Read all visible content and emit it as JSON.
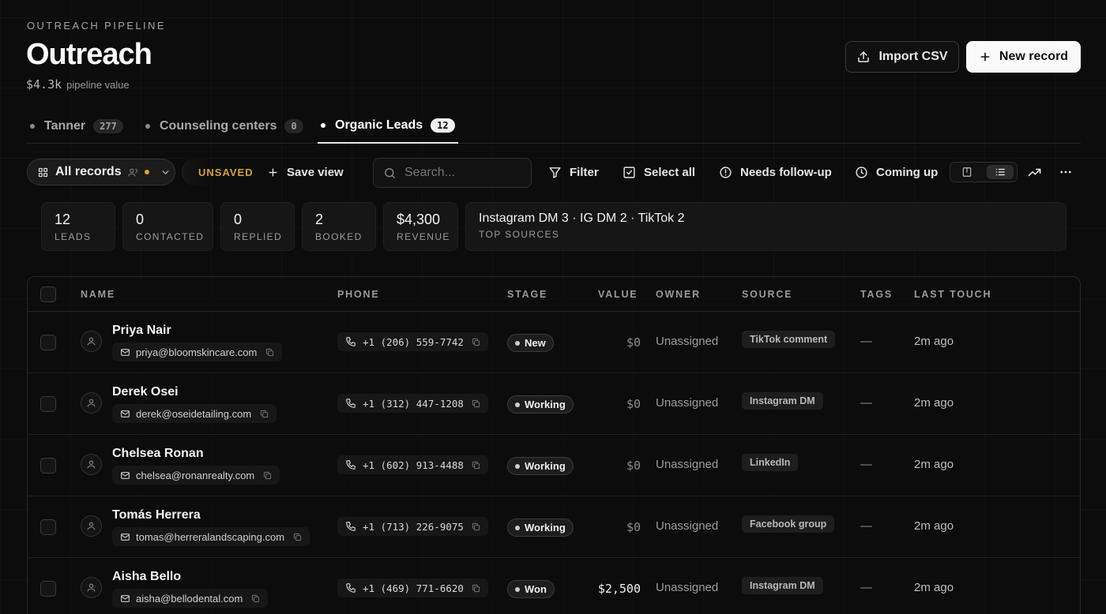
{
  "header": {
    "eyebrow": "OUTREACH PIPELINE",
    "title": "Outreach",
    "pipeline_amount": "$4.3k",
    "pipeline_label": "pipeline value",
    "import_label": "Import CSV",
    "new_label": "New record"
  },
  "tabs": [
    {
      "label": "Tanner",
      "count": "277"
    },
    {
      "label": "Counseling centers",
      "count": "0"
    },
    {
      "label": "Organic Leads",
      "count": "12"
    }
  ],
  "toolbar": {
    "view_label": "All records",
    "unsaved_label": "UNSAVED",
    "save_view_label": "Save view",
    "search_placeholder": "Search...",
    "filter_label": "Filter",
    "select_all_label": "Select all",
    "needs_followup_label": "Needs follow-up",
    "coming_up_label": "Coming up"
  },
  "stats": [
    {
      "value": "12",
      "label": "LEADS"
    },
    {
      "value": "0",
      "label": "CONTACTED"
    },
    {
      "value": "0",
      "label": "REPLIED"
    },
    {
      "value": "2",
      "label": "BOOKED"
    },
    {
      "value": "$4,300",
      "label": "REVENUE"
    },
    {
      "value": "Instagram DM 3 · IG DM 2 · TikTok 2",
      "label": "TOP SOURCES"
    }
  ],
  "table": {
    "columns": [
      "NAME",
      "PHONE",
      "STAGE",
      "VALUE",
      "OWNER",
      "SOURCE",
      "TAGS",
      "LAST TOUCH"
    ],
    "rows": [
      {
        "name": "Priya Nair",
        "email": "priya@bloomskincare.com",
        "phone": "+1 (206) 559-7742",
        "stage": "New",
        "value": "$0",
        "owner": "Unassigned",
        "source": "TikTok comment",
        "tags": "—",
        "last_touch": "2m ago"
      },
      {
        "name": "Derek Osei",
        "email": "derek@oseidetailing.com",
        "phone": "+1 (312) 447-1208",
        "stage": "Working",
        "value": "$0",
        "owner": "Unassigned",
        "source": "Instagram DM",
        "tags": "—",
        "last_touch": "2m ago"
      },
      {
        "name": "Chelsea Ronan",
        "email": "chelsea@ronanrealty.com",
        "phone": "+1 (602) 913-4488",
        "stage": "Working",
        "value": "$0",
        "owner": "Unassigned",
        "source": "LinkedIn",
        "tags": "—",
        "last_touch": "2m ago"
      },
      {
        "name": "Tomás Herrera",
        "email": "tomas@herreralandscaping.com",
        "phone": "+1 (713) 226-9075",
        "stage": "Working",
        "value": "$0",
        "owner": "Unassigned",
        "source": "Facebook group",
        "tags": "—",
        "last_touch": "2m ago"
      },
      {
        "name": "Aisha Bello",
        "email": "aisha@bellodental.com",
        "phone": "+1 (469) 771-6620",
        "stage": "Won",
        "value": "$2,500",
        "owner": "Unassigned",
        "source": "Instagram DM",
        "tags": "—",
        "last_touch": "2m ago"
      }
    ]
  }
}
